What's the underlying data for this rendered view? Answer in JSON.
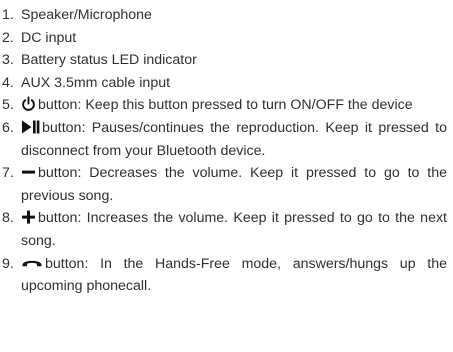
{
  "items": [
    {
      "num": "1.",
      "text": "Speaker/Microphone"
    },
    {
      "num": "2.",
      "text": "DC input"
    },
    {
      "num": "3.",
      "text": "Battery status LED indicator"
    },
    {
      "num": "4.",
      "text": "AUX 3.5mm cable input"
    },
    {
      "num": "5.",
      "icon": "power-icon",
      "text": "button: Keep this button pressed to turn ON/OFF the device"
    },
    {
      "num": "6.",
      "icon": "play-pause-icon",
      "text": "button: Pauses/continues the reproduction. Keep it pressed to disconnect from your Bluetooth device."
    },
    {
      "num": "7.",
      "icon": "minus-icon",
      "text": "button: Decreases the volume. Keep it pressed to go to the previous song."
    },
    {
      "num": "8.",
      "icon": "plus-icon",
      "text": "button: Increases the volume. Keep it pressed to go to the next song."
    },
    {
      "num": "9.",
      "icon": "phone-handset-icon",
      "text": "button: In the Hands-Free mode, answers/hungs up the upcoming phonecall."
    }
  ]
}
